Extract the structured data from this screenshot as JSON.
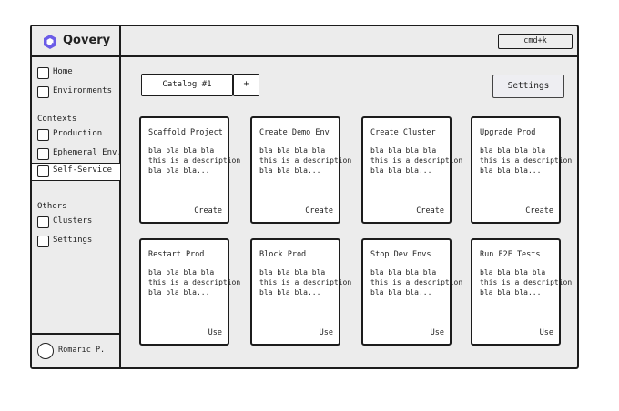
{
  "brand": {
    "name": "Qovery",
    "logo_color": "#6b5ce7",
    "icon": "qovery-logo-icon"
  },
  "topbar": {
    "shortcut_label": "cmd+k"
  },
  "sidebar": {
    "top_items": [
      {
        "label": "Home",
        "icon": "checkbox-icon"
      },
      {
        "label": "Environments",
        "icon": "checkbox-icon"
      }
    ],
    "contexts_label": "Contexts",
    "context_items": [
      {
        "label": "Production",
        "icon": "checkbox-icon"
      },
      {
        "label": "Ephemeral Env.",
        "icon": "checkbox-icon"
      },
      {
        "label": "Self-Service",
        "icon": "checkbox-icon",
        "active": true
      }
    ],
    "others_label": "Others",
    "other_items": [
      {
        "label": "Clusters",
        "icon": "checkbox-icon"
      },
      {
        "label": "Settings",
        "icon": "checkbox-icon"
      }
    ],
    "user": {
      "name": "Romaric P.",
      "icon": "avatar-circle"
    }
  },
  "catalog": {
    "tab_label": "Catalog #1",
    "add_tab_label": "+",
    "settings_label": "Settings"
  },
  "cards": [
    {
      "title": "Scaffold Project",
      "desc": "bla bla bla bla\nthis is a description\nbla bla bla...",
      "action": "Create"
    },
    {
      "title": "Create Demo Env",
      "desc": "bla bla bla bla\nthis is a description\nbla bla bla...",
      "action": "Create"
    },
    {
      "title": "Create Cluster",
      "desc": "bla bla bla bla\nthis is a description\nbla bla bla...",
      "action": "Create"
    },
    {
      "title": "Upgrade Prod",
      "desc": "bla bla bla bla\nthis is a description\nbla bla bla...",
      "action": "Create"
    },
    {
      "title": "Restart Prod",
      "desc": "bla bla bla bla\nthis is a description\nbla bla bla...",
      "action": "Use"
    },
    {
      "title": "Block Prod",
      "desc": "bla bla bla bla\nthis is a description\nbla bla bla...",
      "action": "Use"
    },
    {
      "title": "Stop Dev Envs",
      "desc": "bla bla bla bla\nthis is a description\nbla bla bla...",
      "action": "Use"
    },
    {
      "title": "Run E2E Tests",
      "desc": "bla bla bla bla\nthis is a description\nbla bla bla...",
      "action": "Use"
    }
  ]
}
